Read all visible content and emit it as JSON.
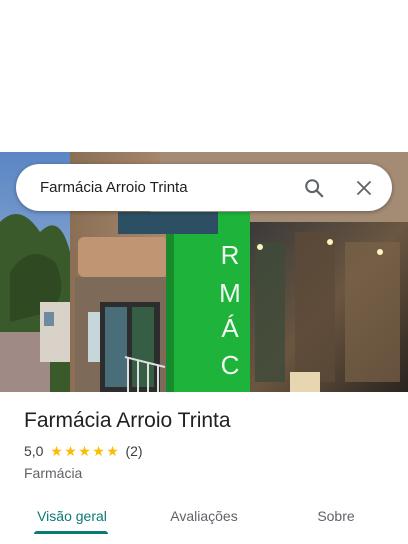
{
  "search": {
    "query": "Farmácia Arroio Trinta",
    "search_icon": "search-icon",
    "clear_icon": "close-icon"
  },
  "photo": {
    "sign_text": "FARMÁCIA",
    "sign_color": "#1eb33a"
  },
  "place": {
    "title": "Farmácia Arroio Trinta",
    "rating": "5,0",
    "stars": 5,
    "review_count": "(2)",
    "category": "Farmácia"
  },
  "tabs": [
    {
      "label": "Visão geral",
      "active": true
    },
    {
      "label": "Avaliações",
      "active": false
    },
    {
      "label": "Sobre",
      "active": false
    }
  ],
  "colors": {
    "accent": "#0b7a73",
    "star": "#fbbc04"
  }
}
